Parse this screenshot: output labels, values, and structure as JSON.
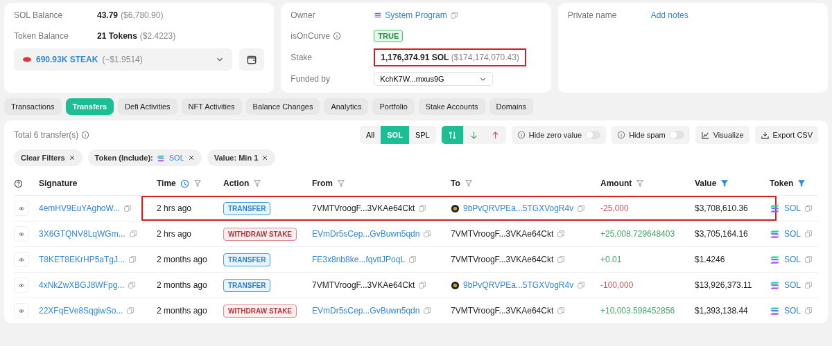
{
  "account_card": {
    "rows": [
      {
        "label": "SOL Balance",
        "value": "43.79",
        "extra": "($6,780.90)"
      },
      {
        "label": "Token Balance",
        "value": "21 Tokens",
        "extra": "($2.4223)"
      }
    ],
    "token_select": {
      "amount": "690.93K STEAK",
      "extra": "(~$1.9514)"
    }
  },
  "info_card": {
    "owner": {
      "label": "Owner",
      "value": "System Program"
    },
    "is_on_curve": {
      "label": "isOnCurve",
      "badge": "TRUE"
    },
    "stake": {
      "label": "Stake",
      "value": "1,176,374.91 SOL",
      "extra": "($174,174,070.43)",
      "highlighted": true
    },
    "funded_by": {
      "label": "Funded by",
      "value": "KchK7W...mxus9G"
    }
  },
  "notes_card": {
    "label": "Private name",
    "link": "Add notes"
  },
  "tabs": [
    {
      "label": "Transactions",
      "selected": false
    },
    {
      "label": "Transfers",
      "selected": true
    },
    {
      "label": "Defi Activities",
      "selected": false
    },
    {
      "label": "NFT Activities",
      "selected": false
    },
    {
      "label": "Balance Changes",
      "selected": false
    },
    {
      "label": "Analytics",
      "selected": false
    },
    {
      "label": "Portfolio",
      "selected": false
    },
    {
      "label": "Stake Accounts",
      "selected": false
    },
    {
      "label": "Domains",
      "selected": false
    }
  ],
  "transfers": {
    "total": "Total 6 transfer(s)",
    "token_filter": [
      {
        "label": "All",
        "selected": false
      },
      {
        "label": "SOL",
        "selected": true
      },
      {
        "label": "SPL",
        "selected": false
      }
    ],
    "direction_filter": [
      {
        "kind": "both",
        "selected": true
      },
      {
        "kind": "in",
        "selected": false
      },
      {
        "kind": "out",
        "selected": false
      }
    ],
    "toggles": [
      {
        "label": "Hide zero value",
        "on": false
      },
      {
        "label": "Hide spam",
        "on": false
      }
    ],
    "actions": [
      {
        "kind": "visualize",
        "label": "Visualize"
      },
      {
        "kind": "export",
        "label": "Export CSV"
      }
    ],
    "filters": [
      {
        "label": "Clear Filters"
      },
      {
        "label": "Token (Include):",
        "token": "SOL"
      },
      {
        "label": "Value: Min 1"
      }
    ],
    "columns": [
      {
        "label": "Signature"
      },
      {
        "label": "Time",
        "clock": true,
        "filtered": false
      },
      {
        "label": "Action",
        "filtered": false
      },
      {
        "label": "From",
        "filtered": false
      },
      {
        "label": "To",
        "filtered": false
      },
      {
        "label": "Amount",
        "filtered": false
      },
      {
        "label": "Value",
        "filtered": true
      },
      {
        "label": "Token",
        "filtered": true
      }
    ],
    "rows": [
      {
        "signature": "4emHV9EuYAghoW...",
        "time": "2 hrs ago",
        "action": {
          "label": "TRANSFER",
          "kind": "transfer"
        },
        "from": {
          "address": "7VMTVroogF...3VKAe64Ckt",
          "link": false,
          "avatar": false
        },
        "to": {
          "address": "9bPvQRVPEa...5TGXVogR4v",
          "link": true,
          "avatar": true
        },
        "amount": {
          "text": "-25,000",
          "kind": "debit"
        },
        "value": "$3,708,610.36",
        "token": "SOL",
        "highlighted": true
      },
      {
        "signature": "3X6GTQNV8LqWGm...",
        "time": "2 hrs ago",
        "action": {
          "label": "WITHDRAW STAKE",
          "kind": "withdraw"
        },
        "from": {
          "address": "EVmDr5sCep...GvBuwn5qdn",
          "link": true,
          "avatar": false
        },
        "to": {
          "address": "7VMTVroogF...3VKAe64Ckt",
          "link": false,
          "avatar": false
        },
        "amount": {
          "text": "+25,008.729648403",
          "kind": "credit"
        },
        "value": "$3,705,164.16",
        "token": "SOL",
        "highlighted": false
      },
      {
        "signature": "T8KET8EKrHP5aTgJ...",
        "time": "2 months ago",
        "action": {
          "label": "TRANSFER",
          "kind": "transfer"
        },
        "from": {
          "address": "FE3x8nb8ke...fqvttJPoqL",
          "link": true,
          "avatar": false
        },
        "to": {
          "address": "7VMTVroogF...3VKAe64Ckt",
          "link": false,
          "avatar": false
        },
        "amount": {
          "text": "+0.01",
          "kind": "credit"
        },
        "value": "$1.4246",
        "token": "SOL",
        "highlighted": false
      },
      {
        "signature": "4xNkZwXBGJ8WFpg...",
        "time": "2 months ago",
        "action": {
          "label": "TRANSFER",
          "kind": "transfer"
        },
        "from": {
          "address": "7VMTVroogF...3VKAe64Ckt",
          "link": false,
          "avatar": false
        },
        "to": {
          "address": "9bPvQRVPEa...5TGXVogR4v",
          "link": true,
          "avatar": true
        },
        "amount": {
          "text": "-100,000",
          "kind": "debit"
        },
        "value": "$13,926,373.11",
        "token": "SOL",
        "highlighted": false
      },
      {
        "signature": "22XFqEVe8SqgiwSo...",
        "time": "2 months ago",
        "action": {
          "label": "WITHDRAW STAKE",
          "kind": "withdraw"
        },
        "from": {
          "address": "EVmDr5sCep...GvBuwn5qdn",
          "link": true,
          "avatar": false
        },
        "to": {
          "address": "7VMTVroogF...3VKAe64Ckt",
          "link": false,
          "avatar": false
        },
        "amount": {
          "text": "+10,003.598452856",
          "kind": "credit"
        },
        "value": "$1,393,138.44",
        "token": "SOL",
        "highlighted": false
      }
    ]
  }
}
